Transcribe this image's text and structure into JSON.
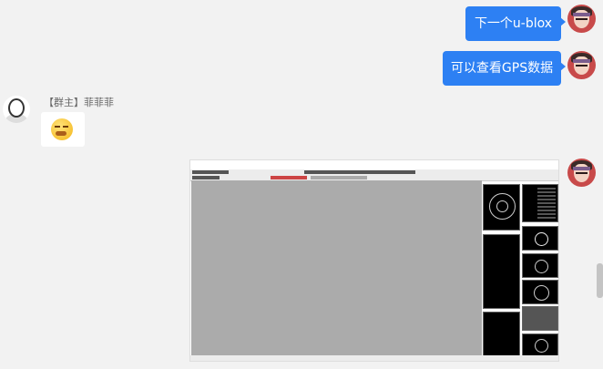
{
  "messages": [
    {
      "from": "me",
      "text": "下一个u-blox"
    },
    {
      "from": "me",
      "text": "可以查看GPS数据"
    },
    {
      "from": "other",
      "sender": "【群主】菲菲菲",
      "emoji": "sneeze-face"
    },
    {
      "from": "me",
      "image": "u-center-screenshot"
    }
  ]
}
